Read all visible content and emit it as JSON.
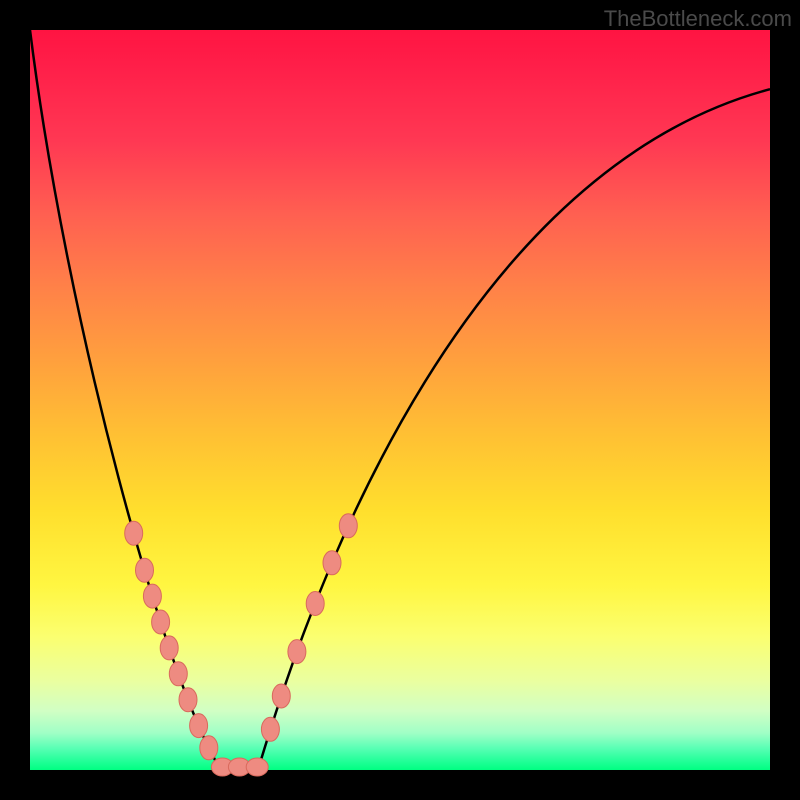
{
  "watermark": "TheBottleneck.com",
  "colors": {
    "frame": "#000000",
    "curve_stroke": "#000000",
    "bead_fill": "#ee8b81",
    "bead_stroke": "#d96a5d"
  },
  "chart_data": {
    "type": "line",
    "title": "",
    "xlabel": "",
    "ylabel": "",
    "x": [
      0.0,
      0.02,
      0.04,
      0.06,
      0.08,
      0.1,
      0.12,
      0.14,
      0.16,
      0.18,
      0.2,
      0.22,
      0.24,
      0.26,
      0.28,
      0.3,
      0.32,
      0.34,
      0.36,
      0.38,
      0.4,
      0.42,
      0.44,
      0.46,
      0.48,
      0.5,
      0.55,
      0.6,
      0.65,
      0.7,
      0.75,
      0.8,
      0.85,
      0.9,
      0.95,
      1.0
    ],
    "values": [
      1.0,
      0.92,
      0.84,
      0.76,
      0.68,
      0.6,
      0.52,
      0.44,
      0.36,
      0.28,
      0.2,
      0.12,
      0.06,
      0.02,
      0.0,
      0.0,
      0.02,
      0.06,
      0.12,
      0.22,
      0.32,
      0.4,
      0.46,
      0.51,
      0.55,
      0.59,
      0.66,
      0.71,
      0.75,
      0.79,
      0.82,
      0.85,
      0.87,
      0.89,
      0.9,
      0.92
    ],
    "xlim": [
      0,
      1
    ],
    "ylim": [
      0,
      1
    ],
    "annotations": {
      "beads_left": [
        {
          "y": 0.32
        },
        {
          "y": 0.27
        },
        {
          "y": 0.235
        },
        {
          "y": 0.2
        },
        {
          "y": 0.165
        },
        {
          "y": 0.13
        },
        {
          "y": 0.095
        },
        {
          "y": 0.06
        },
        {
          "y": 0.03
        }
      ],
      "beads_right": [
        {
          "y": 0.33
        },
        {
          "y": 0.28
        },
        {
          "y": 0.225
        },
        {
          "y": 0.16
        },
        {
          "y": 0.1
        },
        {
          "y": 0.055
        }
      ],
      "beads_bottom": [
        {
          "x": 0.26
        },
        {
          "x": 0.283
        },
        {
          "x": 0.307
        }
      ],
      "notch_x": 0.283,
      "green_band_y": 0.105
    },
    "grid": false,
    "legend": false
  }
}
